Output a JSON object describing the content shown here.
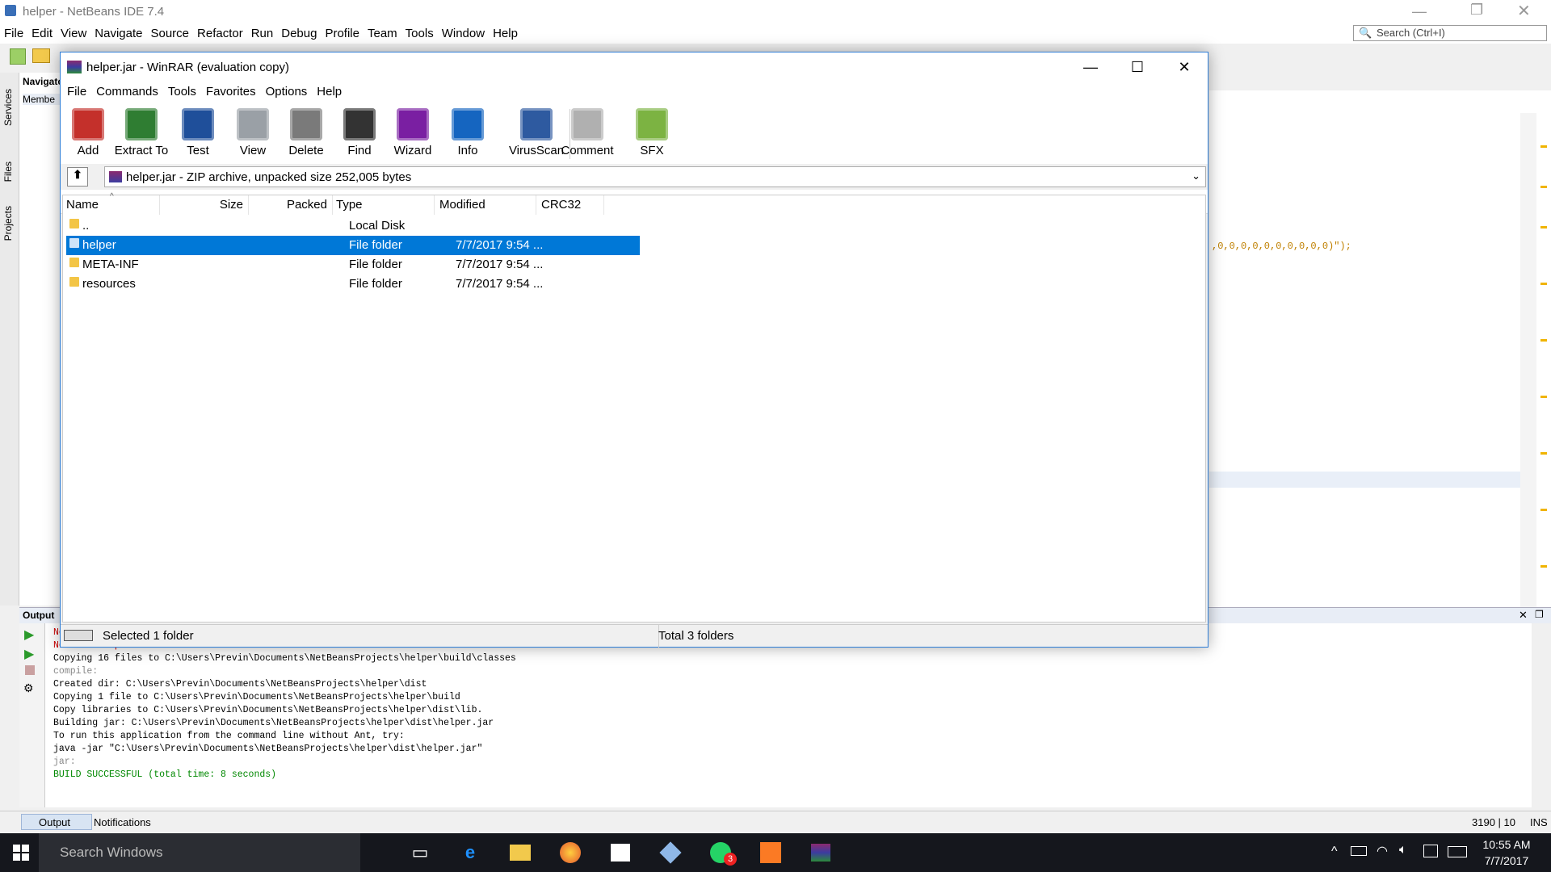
{
  "netbeans": {
    "title": "helper - NetBeans IDE 7.4",
    "menu": [
      "File",
      "Edit",
      "View",
      "Navigate",
      "Source",
      "Refactor",
      "Run",
      "Debug",
      "Profile",
      "Team",
      "Tools",
      "Window",
      "Help"
    ],
    "search_placeholder": "Search (Ctrl+I)",
    "navigator_tab": "Navigato",
    "members_label": "Membe",
    "side_tabs": [
      "Services",
      "Files",
      "Projects"
    ],
    "editor_code": ",0,0,0,0,0,0,0,0,0,0)\");",
    "output_tab": "Output",
    "output_lines": [
      {
        "text": "Note: Some input files use unchecked or unsafe operations.",
        "color": "#cc0000"
      },
      {
        "text": "Note: Recompile with -Xlint:unchecked for details.",
        "color": "#cc0000"
      },
      {
        "text": "Copying 16 files to C:\\Users\\Previn\\Documents\\NetBeansProjects\\helper\\build\\classes",
        "color": "#000000"
      },
      {
        "text": "compile:",
        "color": "#888888"
      },
      {
        "text": "Created dir: C:\\Users\\Previn\\Documents\\NetBeansProjects\\helper\\dist",
        "color": "#000000"
      },
      {
        "text": "Copying 1 file to C:\\Users\\Previn\\Documents\\NetBeansProjects\\helper\\build",
        "color": "#000000"
      },
      {
        "text": "Copy libraries to C:\\Users\\Previn\\Documents\\NetBeansProjects\\helper\\dist\\lib.",
        "color": "#000000"
      },
      {
        "text": "Building jar: C:\\Users\\Previn\\Documents\\NetBeansProjects\\helper\\dist\\helper.jar",
        "color": "#000000"
      },
      {
        "text": "To run this application from the command line without Ant, try:",
        "color": "#000000"
      },
      {
        "text": "java -jar \"C:\\Users\\Previn\\Documents\\NetBeansProjects\\helper\\dist\\helper.jar\"",
        "color": "#000000"
      },
      {
        "text": "jar:",
        "color": "#888888"
      },
      {
        "text": "BUILD SUCCESSFUL (total time: 8 seconds)",
        "color": "#008800"
      }
    ],
    "status_tabs": [
      "Output",
      "Notifications"
    ],
    "status_position": "3190 | 10",
    "status_mode": "INS"
  },
  "winrar": {
    "title": "helper.jar - WinRAR (evaluation copy)",
    "menu": [
      "File",
      "Commands",
      "Tools",
      "Favorites",
      "Options",
      "Help"
    ],
    "toolbar": [
      {
        "label": "Add",
        "icon": "add-icon"
      },
      {
        "label": "Extract To",
        "icon": "extract-icon"
      },
      {
        "label": "Test",
        "icon": "test-icon"
      },
      {
        "label": "View",
        "icon": "view-icon"
      },
      {
        "label": "Delete",
        "icon": "delete-icon"
      },
      {
        "label": "Find",
        "icon": "find-icon"
      },
      {
        "label": "Wizard",
        "icon": "wizard-icon"
      },
      {
        "label": "Info",
        "icon": "info-icon"
      },
      {
        "label": "VirusScan",
        "icon": "virusscan-icon"
      },
      {
        "label": "Comment",
        "icon": "comment-icon"
      },
      {
        "label": "SFX",
        "icon": "sfx-icon"
      }
    ],
    "address": "helper.jar - ZIP archive, unpacked size 252,005 bytes",
    "columns": [
      "Name",
      "Size",
      "Packed",
      "Type",
      "Modified",
      "CRC32"
    ],
    "rows": [
      {
        "name": "..",
        "size": "",
        "packed": "",
        "type": "Local Disk",
        "modified": "",
        "crc": ""
      },
      {
        "name": "helper",
        "size": "",
        "packed": "",
        "type": "File folder",
        "modified": "7/7/2017 9:54 ...",
        "crc": ""
      },
      {
        "name": "META-INF",
        "size": "",
        "packed": "",
        "type": "File folder",
        "modified": "7/7/2017 9:54 ...",
        "crc": ""
      },
      {
        "name": "resources",
        "size": "",
        "packed": "",
        "type": "File folder",
        "modified": "7/7/2017 9:54 ...",
        "crc": ""
      }
    ],
    "selected_row": 1,
    "status_left": "Selected 1 folder",
    "status_right": "Total 3 folders"
  },
  "taskbar": {
    "search_placeholder": "Search Windows",
    "whatsapp_badge": "3",
    "time": "10:55 AM",
    "date": "7/7/2017"
  },
  "colors": {
    "selection": "#0078d7",
    "accent": "#2e7dd6",
    "taskbar": "#15171d"
  }
}
